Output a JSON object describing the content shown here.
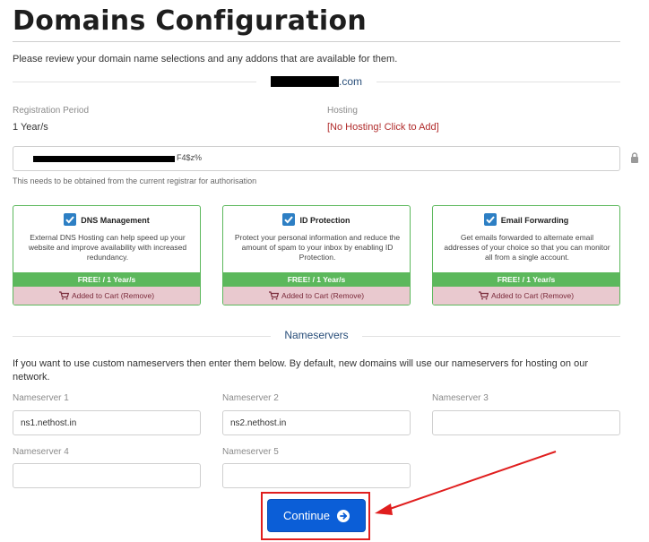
{
  "page": {
    "title": "Domains Configuration",
    "intro": "Please review your domain name selections and any addons that are available for them."
  },
  "domain": {
    "suffix": ".com"
  },
  "registration": {
    "label": "Registration Period",
    "value": "1 Year/s"
  },
  "hosting": {
    "label": "Hosting",
    "link": "[No Hosting! Click to Add]"
  },
  "epp": {
    "visible_tail": "F4$z%",
    "help": "This needs to be obtained from the current registrar for authorisation"
  },
  "addons": [
    {
      "title": "DNS Management",
      "description": "External DNS Hosting can help speed up your website and improve availability with increased redundancy.",
      "price": "FREE! / 1 Year/s",
      "cart": "Added to Cart (Remove)"
    },
    {
      "title": "ID Protection",
      "description": "Protect your personal information and reduce the amount of spam to your inbox by enabling ID Protection.",
      "price": "FREE! / 1 Year/s",
      "cart": "Added to Cart (Remove)"
    },
    {
      "title": "Email Forwarding",
      "description": "Get emails forwarded to alternate email addresses of your choice so that you can monitor all from a single account.",
      "price": "FREE! / 1 Year/s",
      "cart": "Added to Cart (Remove)"
    }
  ],
  "nameservers": {
    "heading": "Nameservers",
    "intro": "If you want to use custom nameservers then enter them below. By default, new domains will use our nameservers for hosting on our network.",
    "fields": [
      {
        "label": "Nameserver 1",
        "value": "ns1.nethost.in"
      },
      {
        "label": "Nameserver 2",
        "value": "ns2.nethost.in"
      },
      {
        "label": "Nameserver 3",
        "value": ""
      },
      {
        "label": "Nameserver 4",
        "value": ""
      },
      {
        "label": "Nameserver 5",
        "value": ""
      }
    ]
  },
  "continue": {
    "label": "Continue"
  },
  "icons": {
    "lock": "lock-icon",
    "check": "checkbox-check-icon",
    "cart": "shopping-cart-icon",
    "arrow": "arrow-circle-right-icon"
  },
  "colors": {
    "accent_blue": "#0b5ed7",
    "addon_green": "#5cb85c",
    "cart_pink": "#e9c9cf",
    "hosting_red": "#b02a2a",
    "annotation_red": "#e01e1e"
  }
}
